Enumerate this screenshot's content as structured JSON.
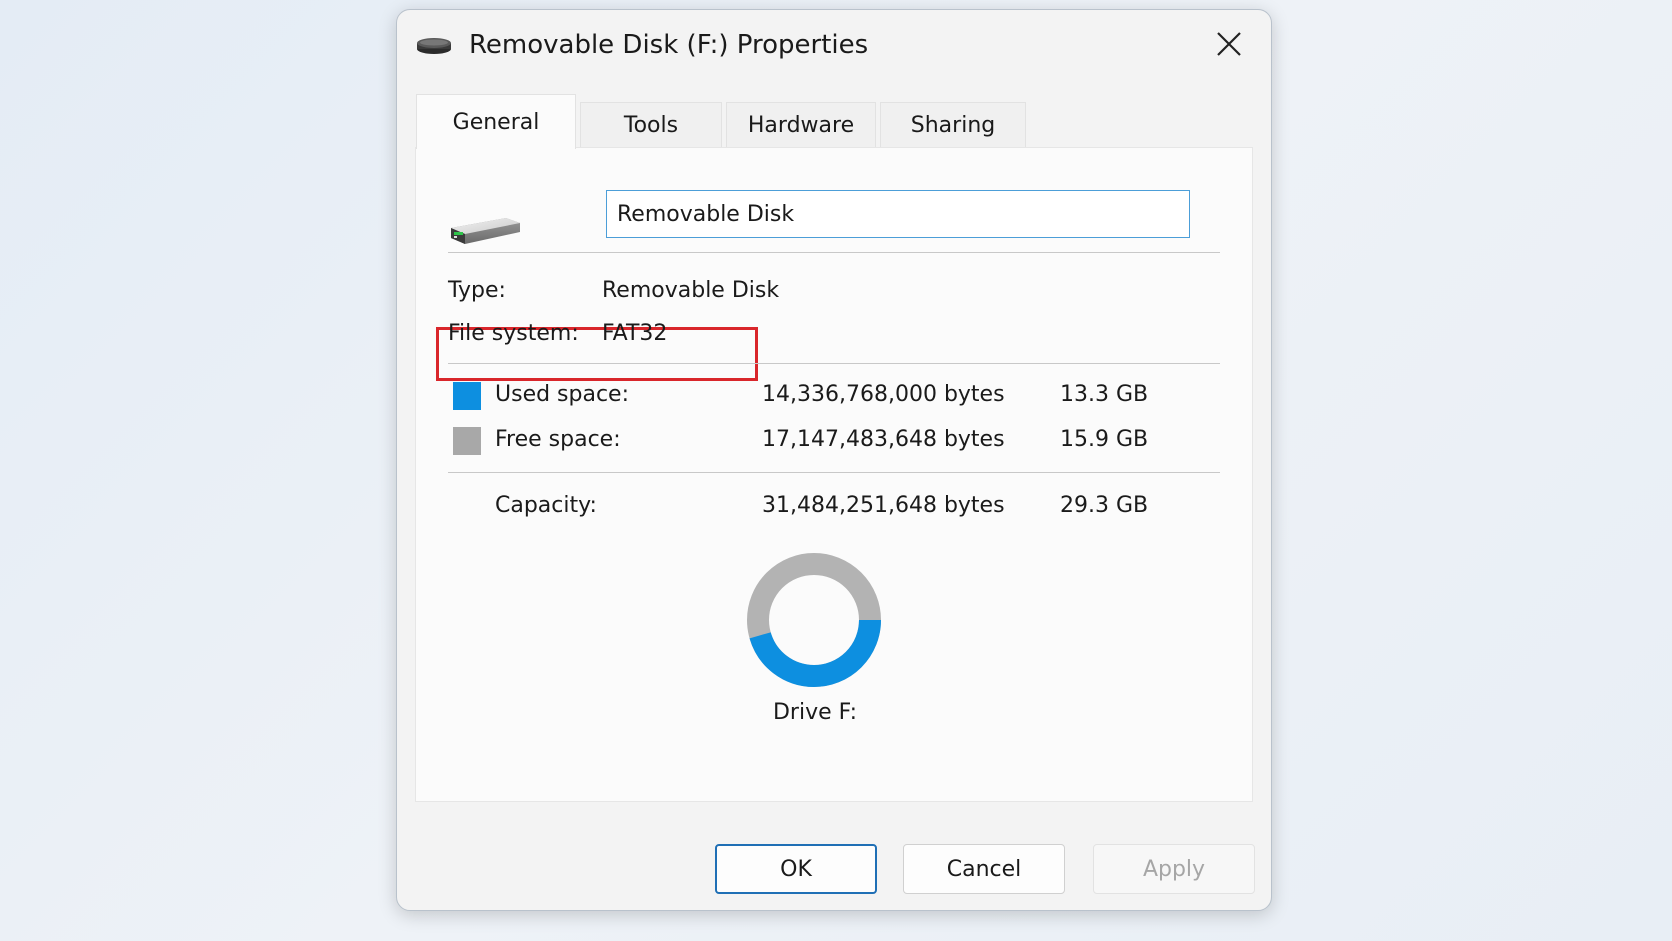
{
  "window": {
    "title": "Removable Disk (F:) Properties",
    "icon": "drive-icon",
    "close_icon": "close-icon"
  },
  "tabs": [
    {
      "label": "General",
      "active": true
    },
    {
      "label": "Tools",
      "active": false
    },
    {
      "label": "Hardware",
      "active": false
    },
    {
      "label": "Sharing",
      "active": false
    }
  ],
  "general": {
    "volume_name": "Removable Disk",
    "type_label": "Type:",
    "type_value": "Removable Disk",
    "fs_label": "File system:",
    "fs_value": "FAT32",
    "used_label": "Used space:",
    "used_bytes": "14,336,768,000 bytes",
    "used_gb": "13.3 GB",
    "free_label": "Free space:",
    "free_bytes": "17,147,483,648 bytes",
    "free_gb": "15.9 GB",
    "capacity_label": "Capacity:",
    "capacity_bytes": "31,484,251,648 bytes",
    "capacity_gb": "29.3 GB",
    "drive_label": "Drive F:"
  },
  "usage": {
    "used_fraction": 0.4554,
    "used_color": "#0d8fe0",
    "free_color": "#b3b3b3",
    "highlight_color": "#d9262b"
  },
  "buttons": {
    "ok": "OK",
    "cancel": "Cancel",
    "apply": "Apply"
  }
}
